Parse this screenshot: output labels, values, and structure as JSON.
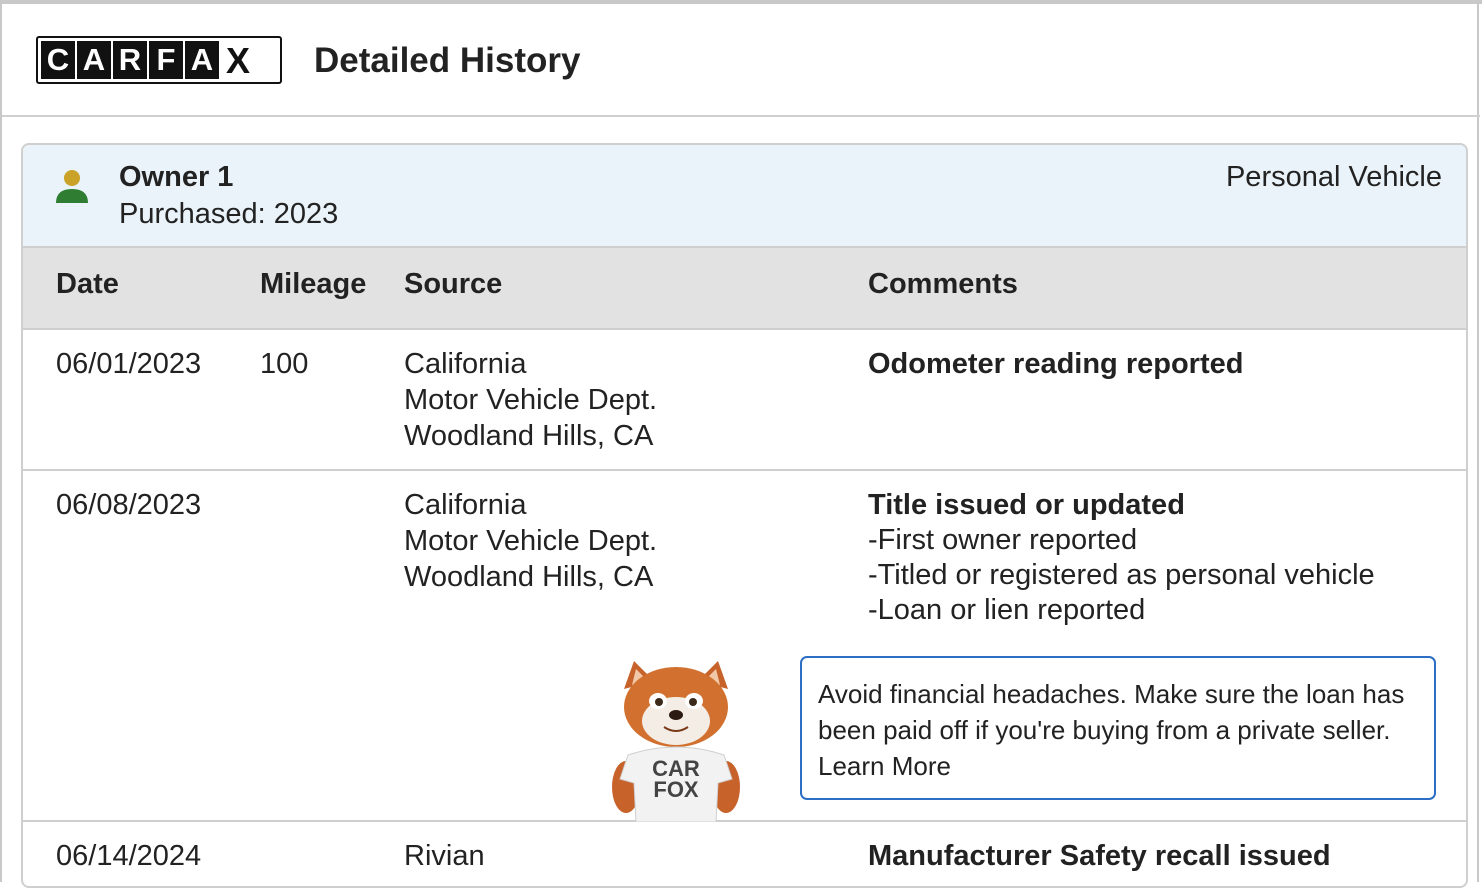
{
  "header": {
    "logo_letters": [
      "C",
      "A",
      "R",
      "F",
      "A",
      "X"
    ],
    "title": "Detailed History"
  },
  "owner": {
    "name": "Owner 1",
    "purchased": "Purchased: 2023",
    "type": "Personal Vehicle"
  },
  "table": {
    "headers": {
      "date": "Date",
      "mileage": "Mileage",
      "source": "Source",
      "comments": "Comments"
    },
    "rows": [
      {
        "date": "06/01/2023",
        "mileage": "100",
        "source": [
          "California",
          "Motor Vehicle Dept.",
          "Woodland Hills, CA"
        ],
        "comment_title": "Odometer reading reported",
        "comment_items": []
      },
      {
        "date": "06/08/2023",
        "mileage": "",
        "source": [
          "California",
          "Motor Vehicle Dept.",
          "Woodland Hills, CA"
        ],
        "comment_title": "Title issued or updated",
        "comment_items": [
          "-First owner reported",
          "-Titled or registered as personal vehicle",
          "-Loan or lien reported"
        ]
      },
      {
        "date": "06/14/2024",
        "mileage": "",
        "source": [
          "Rivian"
        ],
        "comment_title": "Manufacturer Safety recall issued",
        "comment_items": []
      }
    ]
  },
  "tip": {
    "text": "Avoid financial headaches. Make sure the loan has been paid off if you're buying from a private seller.",
    "link": "Learn More"
  },
  "mascot": {
    "shirt_line1": "CAR",
    "shirt_line2": "FOX"
  },
  "colors": {
    "accent_blue": "#2c6fc4",
    "owner_bar_bg": "#eaf3f9",
    "header_bg": "#e2e2e2",
    "person_head": "#c9a227",
    "person_body": "#2e7d32"
  }
}
